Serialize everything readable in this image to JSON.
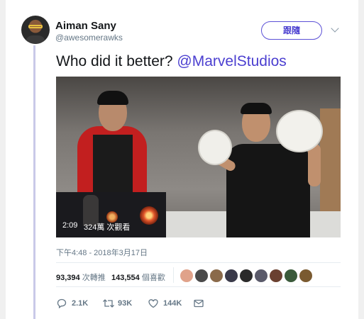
{
  "user": {
    "name": "Aiman Sany",
    "handle": "@awesomerawks"
  },
  "follow_button": {
    "label": "跟隨"
  },
  "tweet": {
    "text": "Who did it better? ",
    "mention": "@MarvelStudios"
  },
  "video": {
    "duration": "2:09",
    "views": "324萬 次觀看"
  },
  "timestamp": "下午4:48 - 2018年3月17日",
  "stats": {
    "retweets_count": "93,394",
    "retweets_label": " 次轉推",
    "likes_count": "143,554",
    "likes_label": " 個喜歡"
  },
  "likers": [
    {
      "icon": "liker-avatar",
      "color": "#e0a28a"
    },
    {
      "icon": "liker-avatar",
      "color": "#4a4a4a"
    },
    {
      "icon": "liker-avatar",
      "color": "#8a6a4a"
    },
    {
      "icon": "liker-avatar",
      "color": "#3a3a4a"
    },
    {
      "icon": "liker-avatar",
      "color": "#2a2a2a"
    },
    {
      "icon": "liker-avatar",
      "color": "#5a5a6a"
    },
    {
      "icon": "liker-avatar",
      "color": "#6a4030"
    },
    {
      "icon": "liker-avatar",
      "color": "#3a5a3a"
    },
    {
      "icon": "liker-avatar",
      "color": "#7a5a30"
    }
  ],
  "actions": {
    "reply_count": "2.1K",
    "retweet_count": "93K",
    "like_count": "144K"
  },
  "colors": {
    "accent": "#4b3fd0",
    "secondary_text": "#657786"
  }
}
